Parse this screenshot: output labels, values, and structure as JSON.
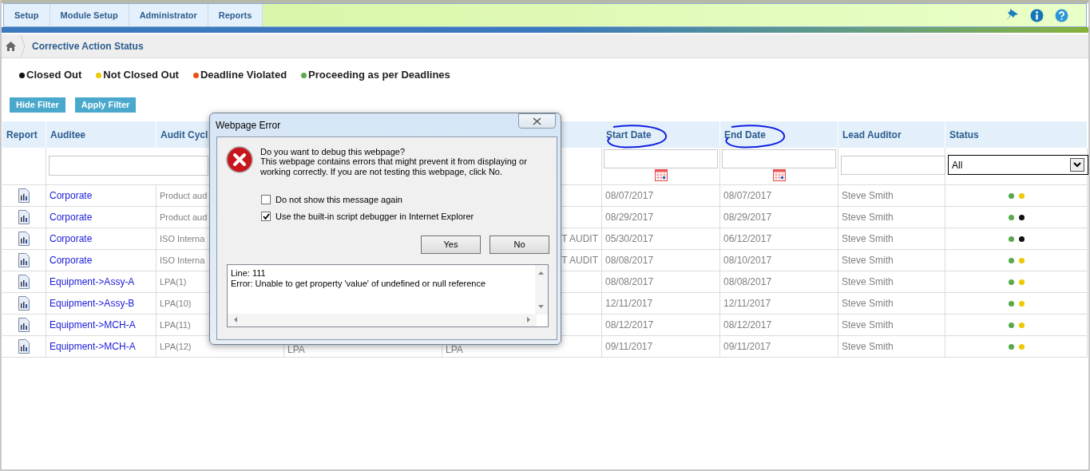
{
  "menu": [
    "Setup",
    "Module Setup",
    "Administrator",
    "Reports"
  ],
  "breadcrumb": "Corrective Action Status",
  "legend": [
    {
      "label": "Closed Out",
      "color": "#111111"
    },
    {
      "label": "Not Closed Out",
      "color": "#f0c800"
    },
    {
      "label": "Deadline Violated",
      "color": "#e8501a"
    },
    {
      "label": "Proceeding as per Deadlines",
      "color": "#5aa84a"
    }
  ],
  "filter_buttons": [
    "Hide Filter",
    "Apply Filter"
  ],
  "table": {
    "columns_left": [
      "Report",
      "Auditee",
      "Audit Cycl"
    ],
    "columns_right": [
      {
        "label": "Start Date",
        "circled": true
      },
      {
        "label": "End Date",
        "circled": true
      },
      {
        "label": "Lead Auditor",
        "circled": false
      },
      {
        "label": "Status",
        "circled": false
      }
    ],
    "status_filter": {
      "value": "All"
    },
    "rows": [
      {
        "auditee": "Corporate",
        "audit_cycle": "Product aud",
        "start_date": "08/07/2017",
        "end_date": "08/07/2017",
        "lead_auditor": "Steve Smith",
        "status": [
          {
            "color": "#5aa84a"
          },
          {
            "color": "#f0c800"
          }
        ]
      },
      {
        "auditee": "Corporate",
        "audit_cycle": "Product aud",
        "start_date": "08/29/2017",
        "end_date": "08/29/2017",
        "lead_auditor": "Steve Smith",
        "status": [
          {
            "color": "#5aa84a"
          },
          {
            "color": "#111111"
          }
        ]
      },
      {
        "auditee": "Corporate",
        "audit_cycle": "ISO Interna",
        "column_5": "T AUDIT",
        "start_date": "05/30/2017",
        "end_date": "06/12/2017",
        "lead_auditor": "Steve Smith",
        "status": [
          {
            "color": "#5aa84a"
          },
          {
            "color": "#111111"
          }
        ]
      },
      {
        "auditee": "Corporate",
        "audit_cycle": "ISO Interna",
        "column_5": "T AUDIT",
        "start_date": "08/08/2017",
        "end_date": "08/10/2017",
        "lead_auditor": "Steve Smith",
        "status": [
          {
            "color": "#5aa84a"
          },
          {
            "color": "#f0c800"
          }
        ]
      },
      {
        "auditee": "Equipment->Assy-A",
        "audit_cycle": "LPA(1)",
        "start_date": "08/08/2017",
        "end_date": "08/08/2017",
        "lead_auditor": "Steve Smith",
        "status": [
          {
            "color": "#5aa84a"
          },
          {
            "color": "#f0c800"
          }
        ]
      },
      {
        "auditee": "Equipment->Assy-B",
        "audit_cycle": "LPA(10)",
        "start_date": "12/11/2017",
        "end_date": "12/11/2017",
        "lead_auditor": "Steve Smith",
        "status": [
          {
            "color": "#5aa84a"
          },
          {
            "color": "#f0c800"
          }
        ]
      },
      {
        "auditee": "Equipment->MCH-A",
        "audit_cycle": "LPA(11)",
        "start_date": "08/12/2017",
        "end_date": "08/12/2017",
        "lead_auditor": "Steve Smith",
        "status": [
          {
            "color": "#5aa84a"
          },
          {
            "color": "#f0c800"
          }
        ]
      },
      {
        "auditee": "Equipment->MCH-A",
        "audit_cycle": "LPA(12)",
        "column_4": "LPA",
        "column_5": "LPA",
        "start_date": "09/11/2017",
        "end_date": "09/11/2017",
        "lead_auditor": "Steve Smith",
        "status": [
          {
            "color": "#5aa84a"
          },
          {
            "color": "#f0c800"
          }
        ]
      }
    ]
  },
  "dialog": {
    "title": "Webpage Error",
    "question": "Do you want to debug this webpage?",
    "message": "This webpage contains errors that might prevent it from displaying or working correctly. If you are not testing this webpage, click No.",
    "options": [
      {
        "label": "Do not show this message again",
        "checked": false
      },
      {
        "label": "Use the built-in script debugger in Internet Explorer",
        "checked": true
      }
    ],
    "buttons": [
      "Yes",
      "No"
    ],
    "details": [
      "Line: 111",
      "Error: Unable to get property 'value' of undefined or null reference"
    ]
  }
}
